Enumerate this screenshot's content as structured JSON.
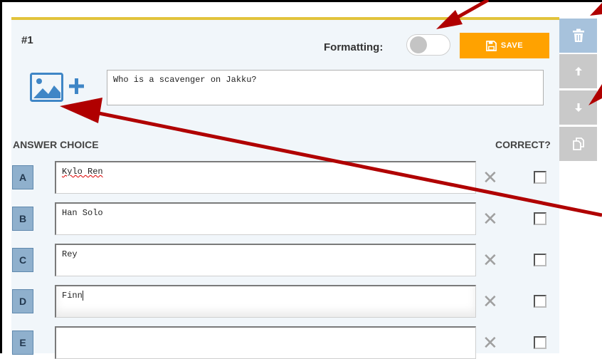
{
  "question": {
    "number": "#1",
    "formatting_label": "Formatting:",
    "formatting_enabled": false,
    "save_label": "SAVE",
    "text": "Who is a scavenger on Jakku?"
  },
  "answers_header": {
    "answer_choice": "ANSWER CHOICE",
    "correct": "CORRECT?"
  },
  "answers": [
    {
      "letter": "A",
      "text": "Kylo Ren",
      "correct": false
    },
    {
      "letter": "B",
      "text": "Han Solo",
      "correct": false
    },
    {
      "letter": "C",
      "text": "Rey",
      "correct": false
    },
    {
      "letter": "D",
      "text": "Finn",
      "correct": false
    },
    {
      "letter": "E",
      "text": "",
      "correct": false
    }
  ],
  "sidebar_tools": [
    "trash-icon",
    "arrow-up-icon",
    "arrow-down-icon",
    "duplicate-icon"
  ],
  "colors": {
    "accent_yellow": "#e2c33b",
    "save_orange": "#ffa200",
    "letter_blue": "#8fb0cd",
    "annotation_red": "#b00000"
  }
}
